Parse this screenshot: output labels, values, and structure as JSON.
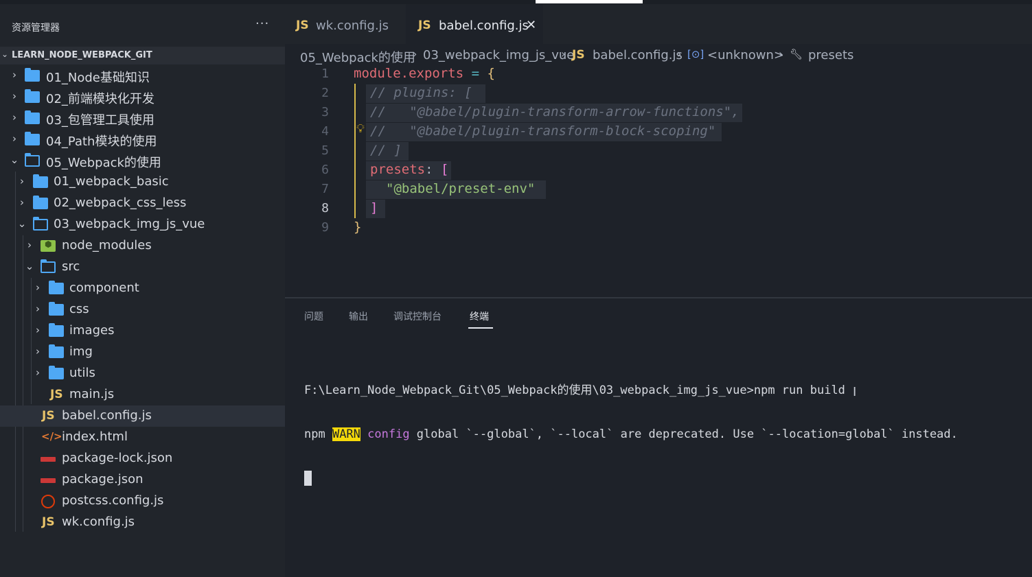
{
  "sidebar": {
    "title": "资源管理器",
    "more": "···",
    "root": "LEARN_NODE_WEBPACK_GIT",
    "items": [
      {
        "label": "01_Node基础知识"
      },
      {
        "label": "02_前端模块化开发"
      },
      {
        "label": "03_包管理工具使用"
      },
      {
        "label": "04_Path模块的使用"
      },
      {
        "label": "05_Webpack的使用"
      },
      {
        "label": "01_webpack_basic"
      },
      {
        "label": "02_webpack_css_less"
      },
      {
        "label": "03_webpack_img_js_vue"
      },
      {
        "label": "node_modules"
      },
      {
        "label": "src"
      },
      {
        "label": "component"
      },
      {
        "label": "css"
      },
      {
        "label": "images"
      },
      {
        "label": "img"
      },
      {
        "label": "utils"
      },
      {
        "label": "main.js"
      },
      {
        "label": "babel.config.js"
      },
      {
        "label": "index.html"
      },
      {
        "label": "package-lock.json"
      },
      {
        "label": "package.json"
      },
      {
        "label": "postcss.config.js"
      },
      {
        "label": "wk.config.js"
      }
    ]
  },
  "tabs": {
    "js_badge": "JS",
    "wk": "wk.config.js",
    "babel": "babel.config.js",
    "close": "✕"
  },
  "breadcrumb": {
    "part1": "05_Webpack的使用",
    "part2": "03_webpack_img_js_vue",
    "part3": "babel.config.js",
    "part4": "<unknown>",
    "part5": "presets",
    "sep": "›"
  },
  "editor": {
    "line_numbers": [
      "1",
      "2",
      "3",
      "4",
      "5",
      "6",
      "7",
      "8",
      "9"
    ],
    "active_line": "8",
    "code": {
      "l1_module": "module.exports",
      "l1_eq": " = ",
      "l1_brace": "{",
      "l2": "// plugins: [",
      "l3": "//   \"@babel/plugin-transform-arrow-functions\",",
      "l4": "//   \"@babel/plugin-transform-block-scoping\"",
      "l5": "// ]",
      "l6_key": "presets",
      "l6_colon": ": ",
      "l6_bracket": "[",
      "l7": "\"@babel/preset-env\"",
      "l8": "]",
      "l9": "}"
    }
  },
  "panel": {
    "tabs": [
      "问题",
      "输出",
      "调试控制台",
      "终端"
    ],
    "active_tab": "终端",
    "terminal": {
      "line1": "F:\\Learn_Node_Webpack_Git\\05_Webpack的使用\\03_webpack_img_js_vue>npm run build",
      "line2_prefix": "npm ",
      "line2_warn": "WARN",
      "line2_kw": " config",
      "line2_rest": " global `--global`, `--local` are deprecated. Use `--location=global` instead."
    },
    "ibeam": "I"
  },
  "colors": {
    "folder": "#4fa8f5",
    "js": "#e9c46a",
    "keyword": "#e06c75",
    "string": "#98c379",
    "comment": "#6b7280",
    "warn_bg": "#f5d90a"
  }
}
